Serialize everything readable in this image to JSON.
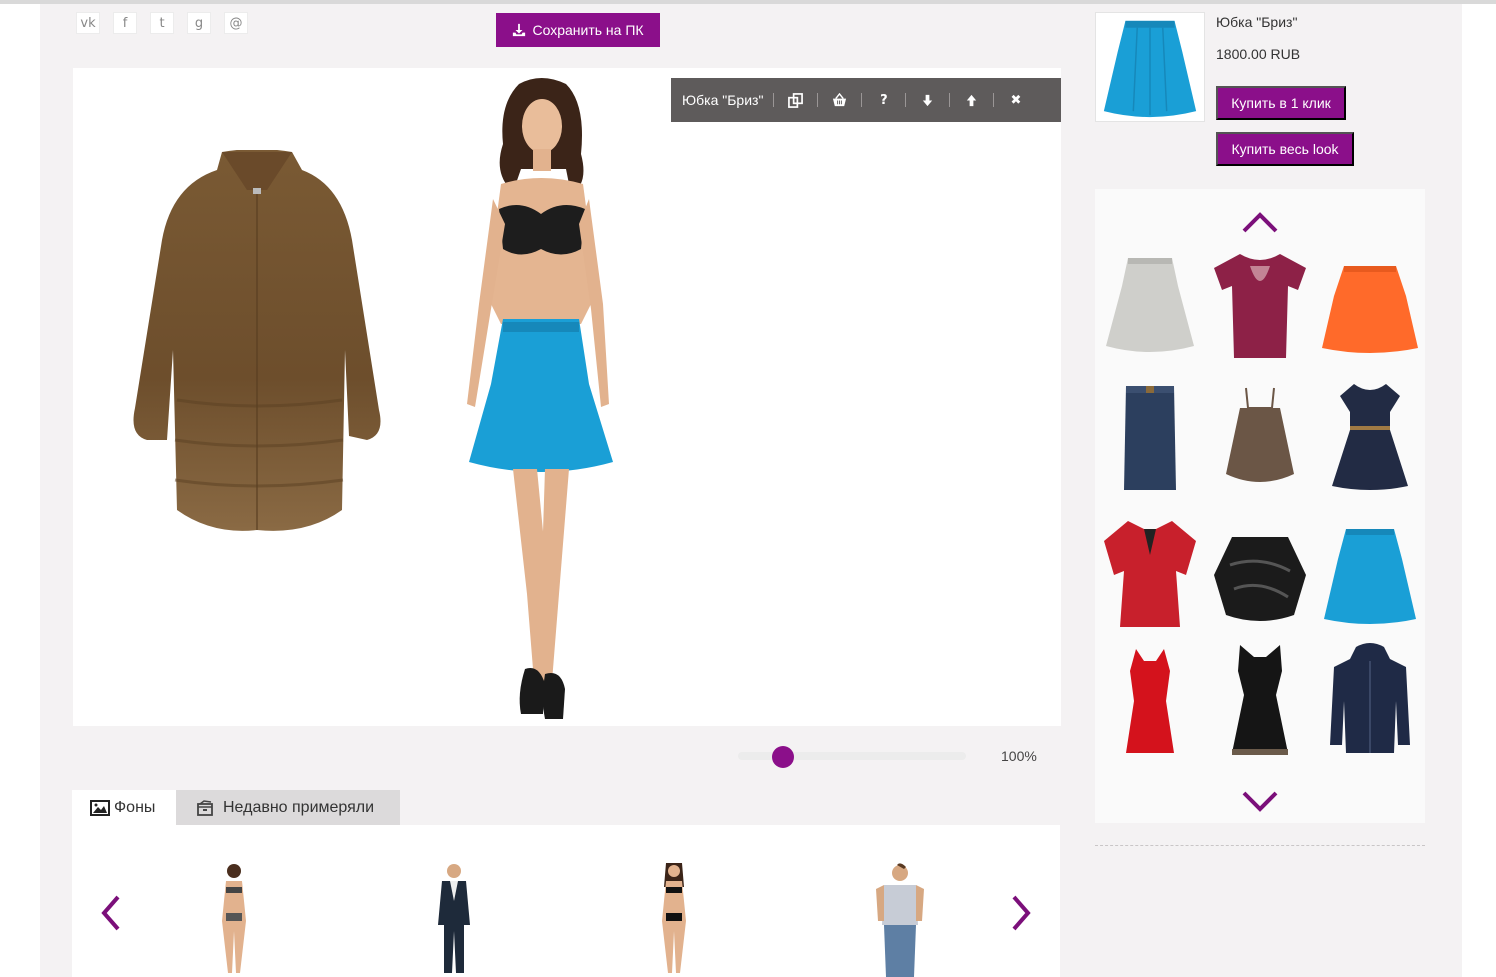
{
  "social": [
    "vk",
    "f",
    "t",
    "g",
    "@"
  ],
  "toolbar_top": {
    "save_label": "Сохранить на ПК"
  },
  "editor": {
    "selected_item": "Юбка \"Бриз\"",
    "actions": [
      "copy-icon",
      "basket-icon",
      "help-icon",
      "move-down-icon",
      "move-up-icon",
      "close-icon"
    ],
    "help_glyph": "?",
    "close_glyph": "✖"
  },
  "zoom": {
    "value_label": "100%",
    "level": 0.2
  },
  "tabs": {
    "backgrounds": "Фоны",
    "recent": "Недавно примеряли"
  },
  "product": {
    "name": "Юбка \"Бриз\"",
    "price": "1800.00 RUB",
    "buy_one": "Купить в 1 клик",
    "buy_look": "Купить весь look"
  },
  "colors": {
    "accent": "#8b0f8a",
    "skirt": "#1a9fd6",
    "toolbar": "#5e5b5b"
  }
}
